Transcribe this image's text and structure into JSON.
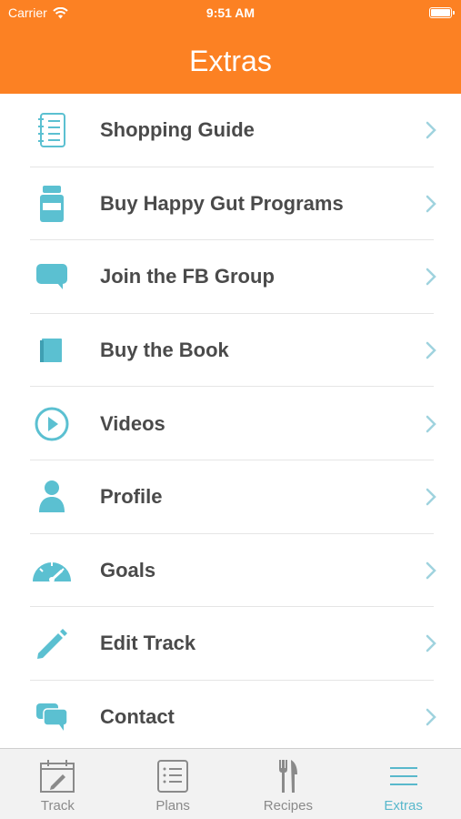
{
  "status_bar": {
    "carrier": "Carrier",
    "time": "9:51 AM"
  },
  "header": {
    "title": "Extras"
  },
  "accent_color": "#FC8123",
  "icon_color": "#5BC0D1",
  "menu": [
    {
      "label": "Shopping Guide",
      "icon": "notebook-icon"
    },
    {
      "label": "Buy Happy Gut Programs",
      "icon": "jar-icon"
    },
    {
      "label": "Join the FB Group",
      "icon": "chat-icon"
    },
    {
      "label": "Buy the Book",
      "icon": "book-icon"
    },
    {
      "label": "Videos",
      "icon": "play-icon"
    },
    {
      "label": "Profile",
      "icon": "person-icon"
    },
    {
      "label": "Goals",
      "icon": "gauge-icon"
    },
    {
      "label": "Edit Track",
      "icon": "pencil-icon"
    },
    {
      "label": "Contact",
      "icon": "chat-bubbles-icon"
    }
  ],
  "tabs": [
    {
      "label": "Track",
      "icon": "calendar-pencil-icon",
      "active": false
    },
    {
      "label": "Plans",
      "icon": "list-document-icon",
      "active": false
    },
    {
      "label": "Recipes",
      "icon": "fork-knife-icon",
      "active": false
    },
    {
      "label": "Extras",
      "icon": "hamburger-menu-icon",
      "active": true
    }
  ]
}
